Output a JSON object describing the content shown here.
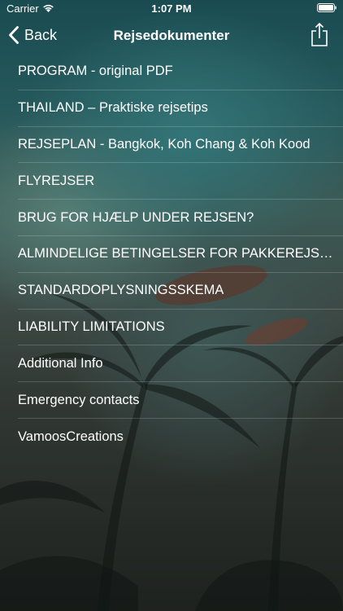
{
  "status_bar": {
    "carrier": "Carrier",
    "time": "1:07 PM"
  },
  "nav": {
    "back_label": "Back",
    "title": "Rejsedokumenter"
  },
  "documents": [
    "PROGRAM - original PDF",
    "THAILAND – Praktiske rejsetips",
    "REJSEPLAN - Bangkok, Koh Chang & Koh Kood",
    "FLYREJSER",
    "BRUG FOR HJÆLP UNDER REJSEN?",
    "ALMINDELIGE BETINGELSER FOR PAKKEREJSE...",
    "STANDARDOPLYSNINGSSKEMA",
    "LIABILITY LIMITATIONS",
    "Additional Info",
    "Emergency contacts",
    "VamoosCreations"
  ]
}
